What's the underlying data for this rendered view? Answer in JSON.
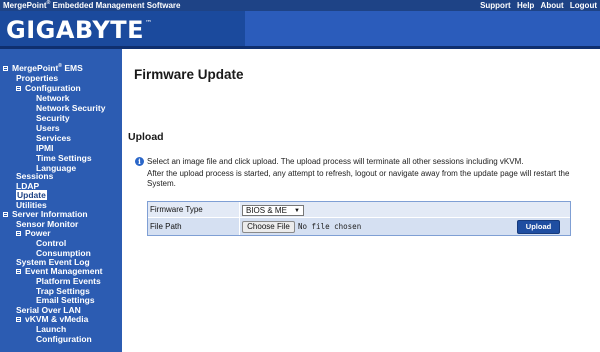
{
  "topbar": {
    "product_name": "MergePoint",
    "product_reg": "®",
    "product_rest": " Embedded Management Software",
    "links": [
      "Support",
      "Help",
      "About",
      "Logout"
    ]
  },
  "banner": {
    "logo": "GIGABYTE",
    "logo_tm": "™"
  },
  "sidebar": {
    "root": {
      "label": "MergePoint",
      "reg": "®",
      "suffix": " EMS"
    },
    "items": [
      "Properties",
      "Configuration",
      "Network",
      "Network Security",
      "Security",
      "Users",
      "Services",
      "IPMI",
      "Time Settings",
      "Language",
      "Sessions",
      "LDAP",
      "Update",
      "Utilities",
      "Server Information",
      "Sensor Monitor",
      "Power",
      "Control",
      "Consumption",
      "System Event Log",
      "Event Management",
      "Platform Events",
      "Trap Settings",
      "Email Settings",
      "Serial Over LAN",
      "vKVM & vMedia",
      "Launch",
      "Configuration"
    ],
    "active": "Update"
  },
  "main": {
    "title": "Firmware Update",
    "section": "Upload",
    "message_line1": "Select an image file and click upload. The upload process will terminate all other sessions including vKVM.",
    "message_line2": "After the upload process is started, any attempt to refresh, logout or navigate away from the update page will restart the",
    "message_line3": "System.",
    "form": {
      "firmware_type_label": "Firmware Type",
      "firmware_type_value": "BIOS & ME",
      "file_path_label": "File Path",
      "choose_file_label": "Choose File",
      "no_file_text": "No file chosen",
      "upload_label": "Upload"
    }
  }
}
